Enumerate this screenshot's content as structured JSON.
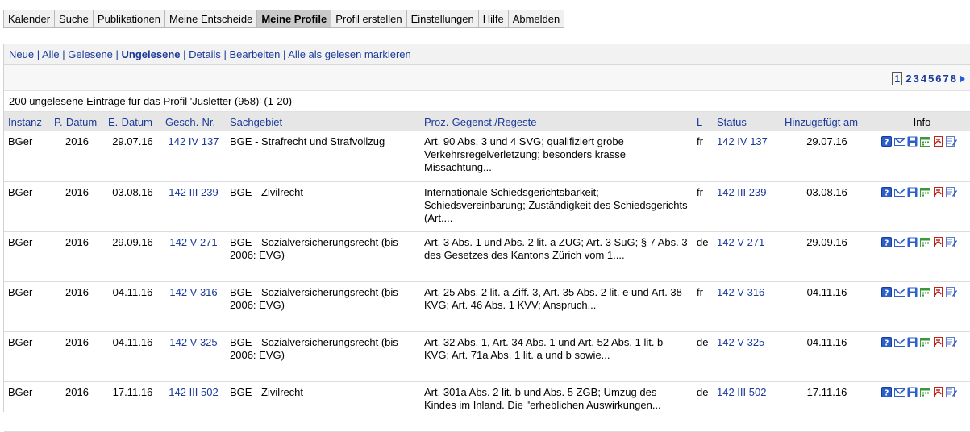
{
  "nav": {
    "tabs": [
      "Kalender",
      "Suche",
      "Publikationen",
      "Meine Entscheide",
      "Meine Profile",
      "Profil erstellen",
      "Einstellungen",
      "Hilfe",
      "Abmelden"
    ],
    "active": "Meine Profile"
  },
  "filters": {
    "items": [
      "Neue",
      "Alle",
      "Gelesene",
      "Ungelesene",
      "Details",
      "Bearbeiten",
      "Alle als gelesen markieren"
    ],
    "current": "Ungelesene"
  },
  "pager": {
    "current": "1",
    "pages": [
      "2",
      "3",
      "4",
      "5",
      "6",
      "7",
      "8"
    ]
  },
  "summary": "200 ungelesene Einträge für das Profil 'Jusletter (958)' (1-20)",
  "table": {
    "headers": {
      "instanz": "Instanz",
      "pdatum": "P.-Datum",
      "edatum": "E.-Datum",
      "geschnr": "Gesch.-Nr.",
      "sachgebiet": "Sachgebiet",
      "regeste": "Proz.-Gegenst./Regeste",
      "lang": "L",
      "status": "Status",
      "added": "Hinzugefügt am",
      "info": "Info"
    },
    "rows": [
      {
        "instanz": "BGer",
        "pdatum": "2016",
        "edatum": "29.07.16",
        "geschnr": "142 IV 137",
        "sachgebiet": "BGE - Strafrecht und Strafvollzug",
        "regeste": "Art. 90 Abs. 3 und 4 SVG; qualifiziert grobe Verkehrsregelverletzung; besonders krasse Missachtung...",
        "lang": "fr",
        "status": "142 IV 137",
        "added": "29.07.16"
      },
      {
        "instanz": "BGer",
        "pdatum": "2016",
        "edatum": "03.08.16",
        "geschnr": "142 III 239",
        "sachgebiet": "BGE - Zivilrecht",
        "regeste": "Internationale Schiedsgerichtsbarkeit; Schiedsvereinbarung; Zuständigkeit des Schiedsgerichts (Art....",
        "lang": "fr",
        "status": "142 III 239",
        "added": "03.08.16"
      },
      {
        "instanz": "BGer",
        "pdatum": "2016",
        "edatum": "29.09.16",
        "geschnr": "142 V 271",
        "sachgebiet": "BGE - Sozialversicherungsrecht (bis 2006: EVG)",
        "regeste": "Art. 3 Abs. 1 und Abs. 2 lit. a ZUG; Art. 3 SuG; § 7 Abs. 3 des Gesetzes des Kantons Zürich vom 1....",
        "lang": "de",
        "status": "142 V 271",
        "added": "29.09.16"
      },
      {
        "instanz": "BGer",
        "pdatum": "2016",
        "edatum": "04.11.16",
        "geschnr": "142 V 316",
        "sachgebiet": "BGE - Sozialversicherungsrecht (bis 2006: EVG)",
        "regeste": "Art. 25 Abs. 2 lit. a Ziff. 3, Art. 35 Abs. 2 lit. e und Art. 38 KVG; Art. 46 Abs. 1 KVV; Anspruch...",
        "lang": "fr",
        "status": "142 V 316",
        "added": "04.11.16"
      },
      {
        "instanz": "BGer",
        "pdatum": "2016",
        "edatum": "04.11.16",
        "geschnr": "142 V 325",
        "sachgebiet": "BGE - Sozialversicherungsrecht (bis 2006: EVG)",
        "regeste": "Art. 32 Abs. 1, Art. 34 Abs. 1 und Art. 52 Abs. 1 lit. b KVG; Art. 71a Abs. 1 lit. a und b sowie...",
        "lang": "de",
        "status": "142 V 325",
        "added": "04.11.16"
      },
      {
        "instanz": "BGer",
        "pdatum": "2016",
        "edatum": "17.11.16",
        "geschnr": "142 III 502",
        "sachgebiet": "BGE - Zivilrecht",
        "regeste": "Art. 301a Abs. 2 lit. b und Abs. 5 ZGB; Umzug des Kindes im Inland. Die \"erheblichen Auswirkungen...",
        "lang": "de",
        "status": "142 III 502",
        "added": "17.11.16"
      }
    ],
    "info_icons": [
      "help-icon",
      "mail-icon",
      "save-icon",
      "calendar-icon",
      "pdf-icon",
      "edit-icon"
    ]
  },
  "colors": {
    "link": "#1a3a9a",
    "header_bg": "#e6e6e6",
    "active_tab_bg": "#c9c9c9"
  }
}
